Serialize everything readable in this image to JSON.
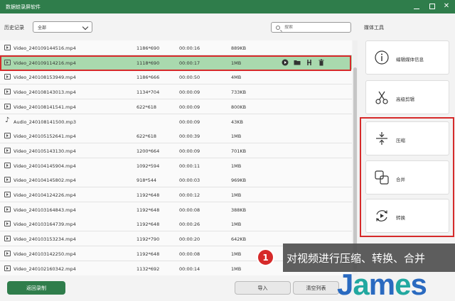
{
  "window": {
    "title": "数据蛙录屏软件"
  },
  "toolbar": {
    "history_label": "历史记录",
    "filter_value": "全部",
    "search_placeholder": "搜索"
  },
  "sidebar": {
    "title": "媒体工具",
    "tools": [
      {
        "label": "编辑媒体信息",
        "icon": "info-icon"
      },
      {
        "label": "高级剪辑",
        "icon": "scissors-icon"
      },
      {
        "label": "压缩",
        "icon": "compress-icon"
      },
      {
        "label": "合并",
        "icon": "merge-icon"
      },
      {
        "label": "转换",
        "icon": "convert-icon"
      }
    ]
  },
  "rows": [
    {
      "name": "Video_240109144516.mp4",
      "res": "1186*690",
      "dur": "00:00:16",
      "size": "889KB",
      "type": "video"
    },
    {
      "name": "Video_240109114216.mp4",
      "res": "1118*690",
      "dur": "00:00:17",
      "size": "1MB",
      "type": "video",
      "selected": true
    },
    {
      "name": "Video_240108153949.mp4",
      "res": "1186*666",
      "dur": "00:00:50",
      "size": "4MB",
      "type": "video"
    },
    {
      "name": "Video_240108143013.mp4",
      "res": "1134*704",
      "dur": "00:00:09",
      "size": "733KB",
      "type": "video"
    },
    {
      "name": "Video_240108141541.mp4",
      "res": "622*618",
      "dur": "00:00:09",
      "size": "800KB",
      "type": "video"
    },
    {
      "name": "Audio_240108141500.mp3",
      "res": "",
      "dur": "00:00:09",
      "size": "43KB",
      "type": "audio"
    },
    {
      "name": "Video_240105152641.mp4",
      "res": "622*618",
      "dur": "00:00:39",
      "size": "1MB",
      "type": "video"
    },
    {
      "name": "Video_240105143130.mp4",
      "res": "1200*664",
      "dur": "00:00:09",
      "size": "701KB",
      "type": "video"
    },
    {
      "name": "Video_240104145904.mp4",
      "res": "1092*594",
      "dur": "00:00:11",
      "size": "1MB",
      "type": "video"
    },
    {
      "name": "Video_240104145802.mp4",
      "res": "918*544",
      "dur": "00:00:03",
      "size": "969KB",
      "type": "video"
    },
    {
      "name": "Video_240104124226.mp4",
      "res": "1192*648",
      "dur": "00:00:12",
      "size": "1MB",
      "type": "video"
    },
    {
      "name": "Video_240103164843.mp4",
      "res": "1192*648",
      "dur": "00:00:08",
      "size": "388KB",
      "type": "video"
    },
    {
      "name": "Video_240103164739.mp4",
      "res": "1192*648",
      "dur": "00:00:26",
      "size": "1MB",
      "type": "video"
    },
    {
      "name": "Video_240103153234.mp4",
      "res": "1192*790",
      "dur": "00:00:20",
      "size": "642KB",
      "type": "video"
    },
    {
      "name": "Video_240103142250.mp4",
      "res": "1192*648",
      "dur": "00:00:08",
      "size": "1MB",
      "type": "video"
    },
    {
      "name": "Video_240102160342.mp4",
      "res": "1132*692",
      "dur": "00:00:14",
      "size": "1MB",
      "type": "video"
    }
  ],
  "footer": {
    "back_label": "返回录制",
    "import_label": "导入",
    "clear_label": "清空列表"
  },
  "callout": {
    "number": "1",
    "text": "对视频进行压缩、转换、合并"
  },
  "watermark": {
    "text": "James"
  },
  "colors": {
    "brand_green": "#2f7d4b",
    "selected_row": "#a9d9ae",
    "highlight_red": "#d62a2a"
  }
}
